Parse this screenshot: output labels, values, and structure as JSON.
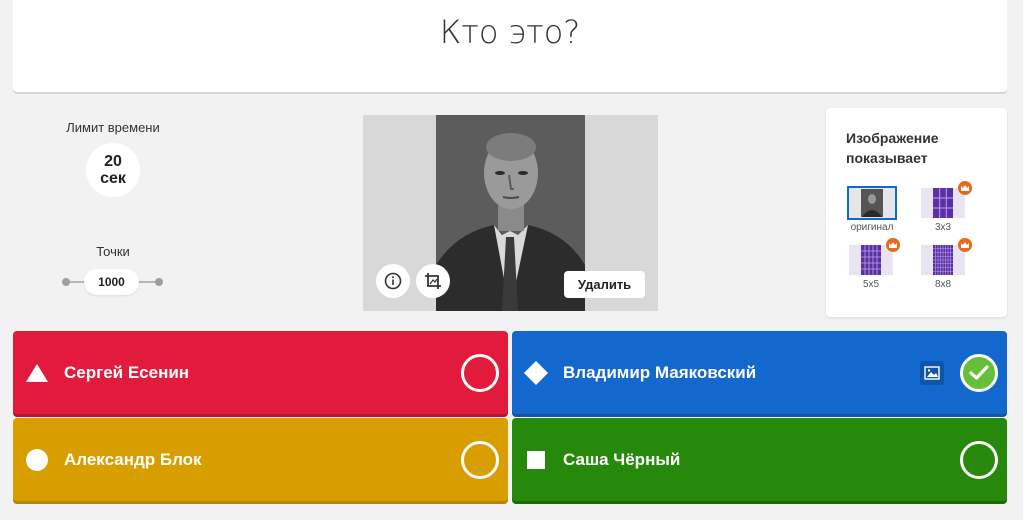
{
  "question": {
    "text": "Кто это?"
  },
  "settings": {
    "time_limit_label": "Лимит времени",
    "time_value": "20",
    "time_unit": "сек",
    "points_label": "Точки",
    "points_value": "1000"
  },
  "media": {
    "delete_label": "Удалить",
    "info_icon": "info-icon",
    "crop_icon": "crop-icon"
  },
  "reveal": {
    "title_line1": "Изображение",
    "title_line2": "показывает",
    "options": [
      {
        "label": "оригинал",
        "selected": true,
        "premium": false
      },
      {
        "label": "3x3",
        "selected": false,
        "premium": true
      },
      {
        "label": "5x5",
        "selected": false,
        "premium": true
      },
      {
        "label": "8x8",
        "selected": false,
        "premium": true
      }
    ]
  },
  "answers": [
    {
      "shape": "triangle",
      "text": "Сергей Есенин",
      "correct": false,
      "color": "#e21b3c"
    },
    {
      "shape": "diamond",
      "text": "Владимир Маяковский",
      "correct": true,
      "color": "#1368ce"
    },
    {
      "shape": "circle",
      "text": "Александр Блок",
      "correct": false,
      "color": "#d89e00"
    },
    {
      "shape": "square",
      "text": "Саша Чёрный",
      "correct": false,
      "color": "#26890c"
    }
  ]
}
